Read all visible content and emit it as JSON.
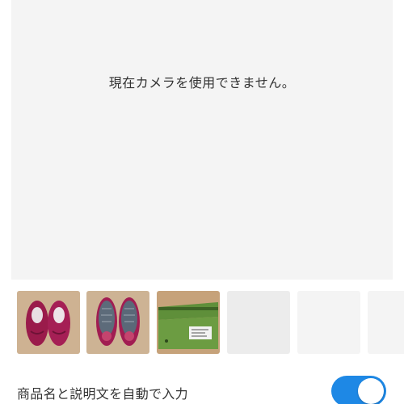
{
  "camera": {
    "message": "現在カメラを使用できません。"
  },
  "thumbnails": [
    {
      "icon": "shoes-top-photo",
      "filled": true
    },
    {
      "icon": "shoes-sole-photo",
      "filled": true
    },
    {
      "icon": "shoe-box-photo",
      "filled": true
    },
    {
      "filled": false
    },
    {
      "filled": false
    },
    {
      "filled": false
    }
  ],
  "settings": {
    "auto_fill_label": "商品名と説明文を自動で入力",
    "auto_fill_enabled": true
  },
  "colors": {
    "toggle_on": "#1e88e5",
    "camera_bg": "#f4f4f4",
    "placeholder_bg": "#ececec"
  }
}
